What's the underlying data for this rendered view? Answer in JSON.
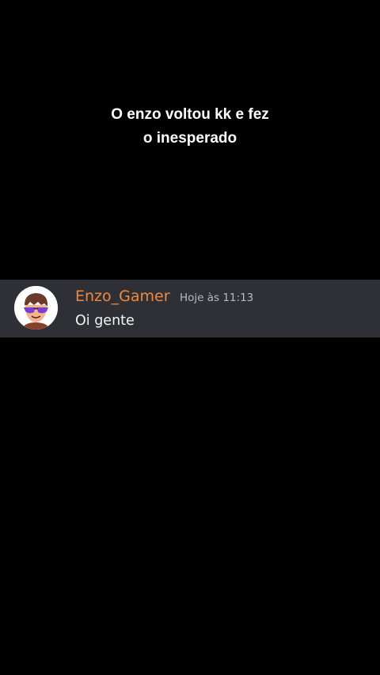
{
  "caption": {
    "line1": "O enzo voltou kk e fez",
    "line2": "o inesperado"
  },
  "message": {
    "author": "Enzo_Gamer",
    "author_color": "#f0883e",
    "timestamp": "Hoje às 11:13",
    "content": "Oi gente",
    "avatar_icon": "roblox-avatar-sunglasses-icon"
  },
  "colors": {
    "background": "#000000",
    "message_bg": "#2e3035"
  }
}
